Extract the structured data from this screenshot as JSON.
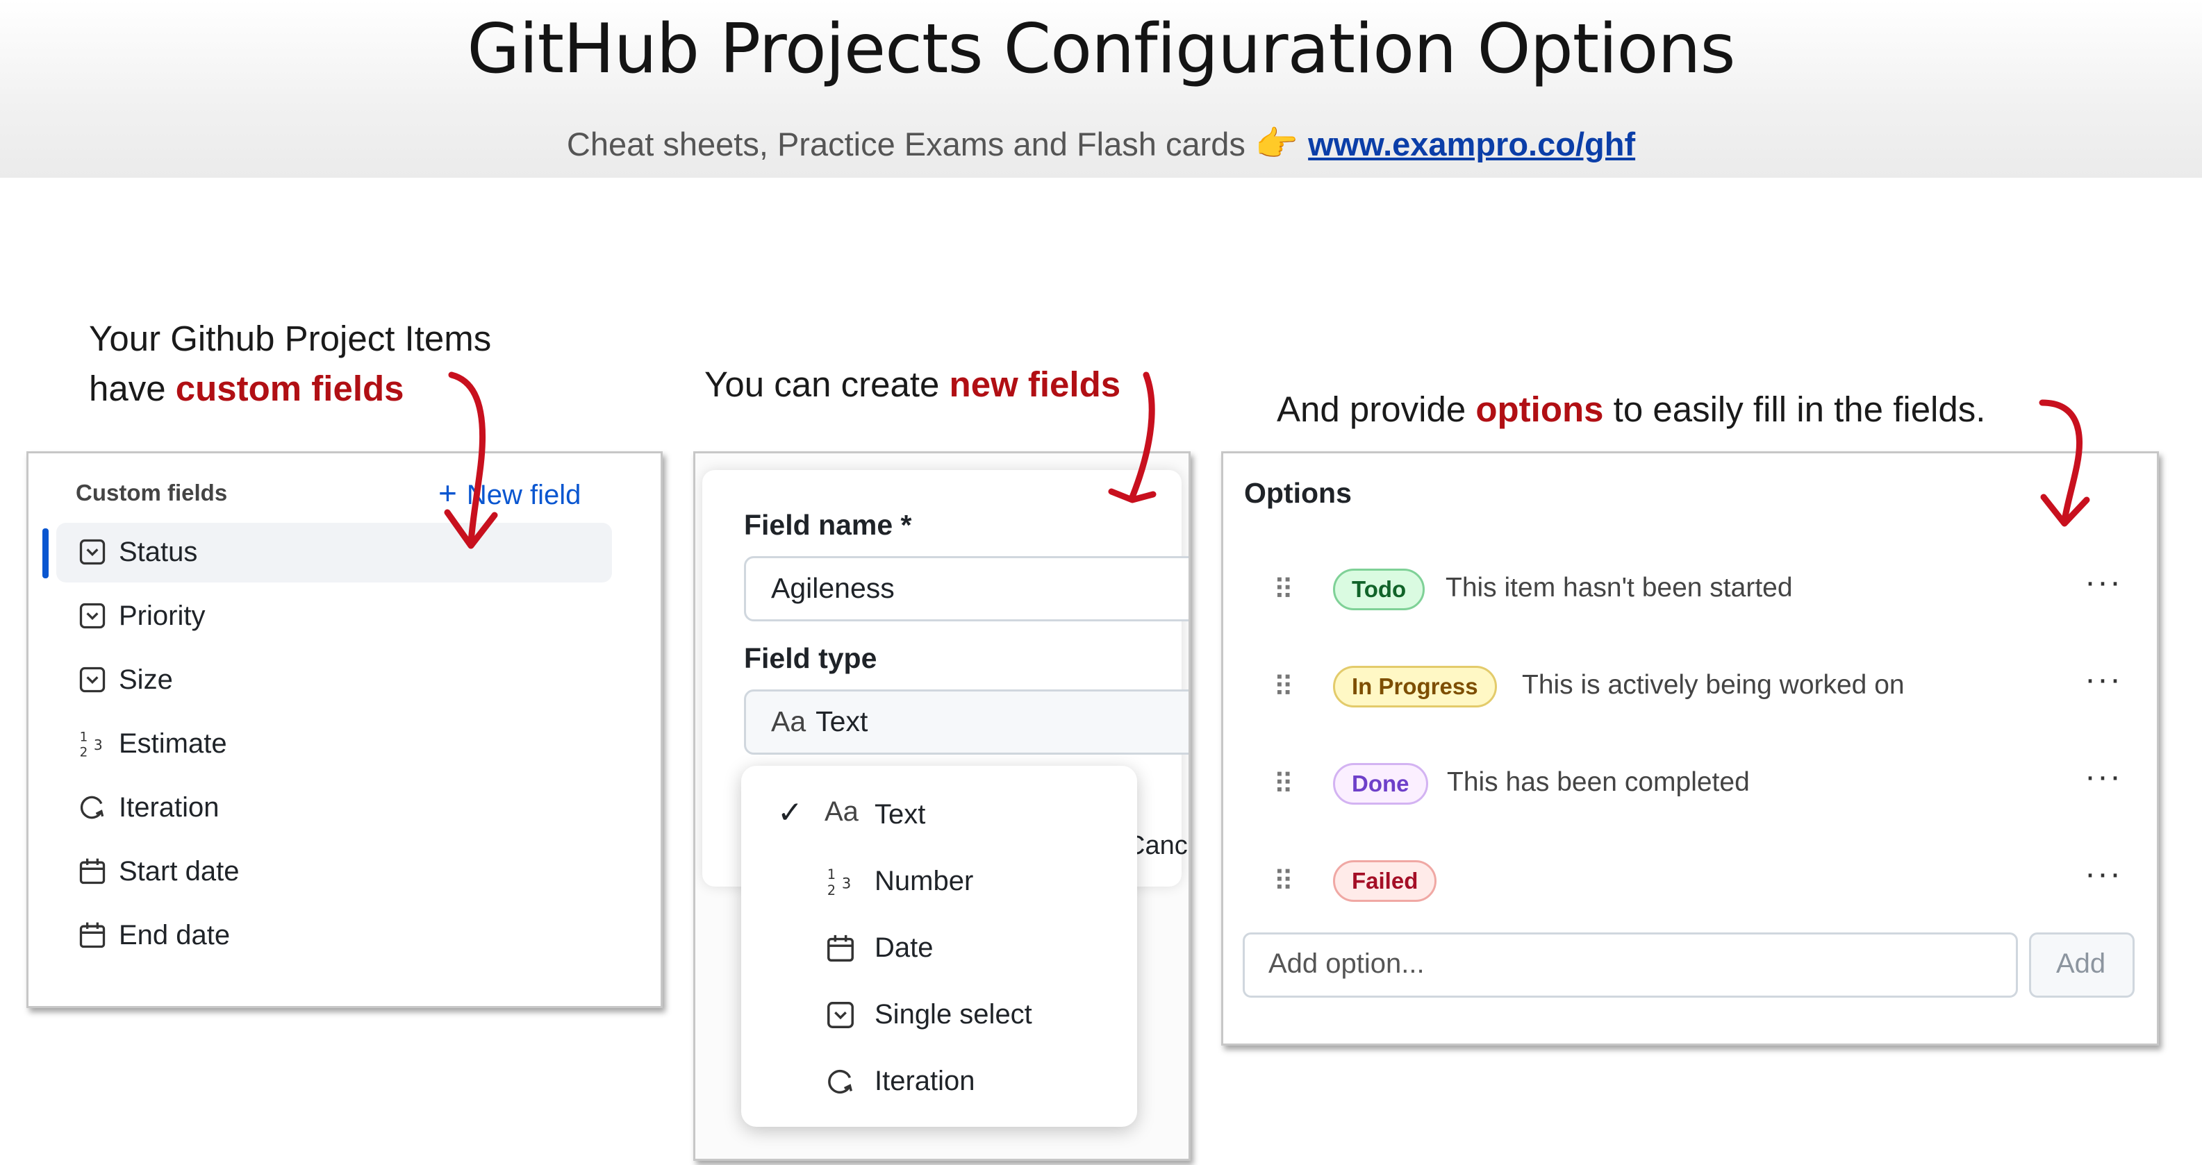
{
  "header": {
    "title": "GitHub Projects Configuration Options",
    "subtitle": "Cheat sheets, Practice Exams and Flash cards",
    "hand_icon": "pointing-hand-icon",
    "link": "www.exampro.co/ghf"
  },
  "captions": {
    "left_line1": "Your Github Project Items",
    "left_line2_prefix": "have ",
    "left_line2_highlight": "custom fields",
    "middle_prefix": "You can create ",
    "middle_highlight": "new fields",
    "right_prefix": "And provide ",
    "right_highlight": "options",
    "right_suffix": " to easily fill in the fields."
  },
  "custom_fields": {
    "heading": "Custom fields",
    "new_field_label": "New field",
    "items": [
      {
        "label": "Status",
        "icon": "single-select-icon",
        "selected": true
      },
      {
        "label": "Priority",
        "icon": "single-select-icon"
      },
      {
        "label": "Size",
        "icon": "single-select-icon"
      },
      {
        "label": "Estimate",
        "icon": "number-icon"
      },
      {
        "label": "Iteration",
        "icon": "iteration-icon"
      },
      {
        "label": "Start date",
        "icon": "calendar-icon"
      },
      {
        "label": "End date",
        "icon": "calendar-icon"
      }
    ]
  },
  "new_field_form": {
    "name_label": "Field name *",
    "name_value": "Agileness",
    "type_label": "Field type",
    "type_value_glyph": "Aa",
    "type_value": "Text",
    "cancel_partial": "Canc",
    "type_options": [
      {
        "glyph": "Aa",
        "label": "Text",
        "checked": true,
        "icon": "text-icon"
      },
      {
        "glyph": "",
        "label": "Number",
        "icon": "number-icon"
      },
      {
        "glyph": "",
        "label": "Date",
        "icon": "calendar-icon"
      },
      {
        "glyph": "",
        "label": "Single select",
        "icon": "single-select-icon"
      },
      {
        "glyph": "",
        "label": "Iteration",
        "icon": "iteration-icon"
      }
    ]
  },
  "options_panel": {
    "heading": "Options",
    "options": [
      {
        "label": "Todo",
        "description": "This item hasn't been started",
        "bg": "#dafbe1",
        "border": "#7fd197",
        "color": "#116329"
      },
      {
        "label": "In Progress",
        "description": "This is actively being worked on",
        "bg": "#fff8c5",
        "border": "#e3cb6b",
        "color": "#7d4e00"
      },
      {
        "label": "Done",
        "description": "This has been completed",
        "bg": "#fbefff",
        "border": "#d3b3f2",
        "color": "#6e40c9"
      },
      {
        "label": "Failed",
        "description": "",
        "bg": "#ffebe9",
        "border": "#f0a8a4",
        "color": "#a40e26"
      }
    ],
    "add_placeholder": "Add option...",
    "add_button": "Add"
  },
  "colors": {
    "highlight_red": "#b10f14",
    "link_blue": "#0b3ea8",
    "accent_blue": "#0a56d0"
  }
}
